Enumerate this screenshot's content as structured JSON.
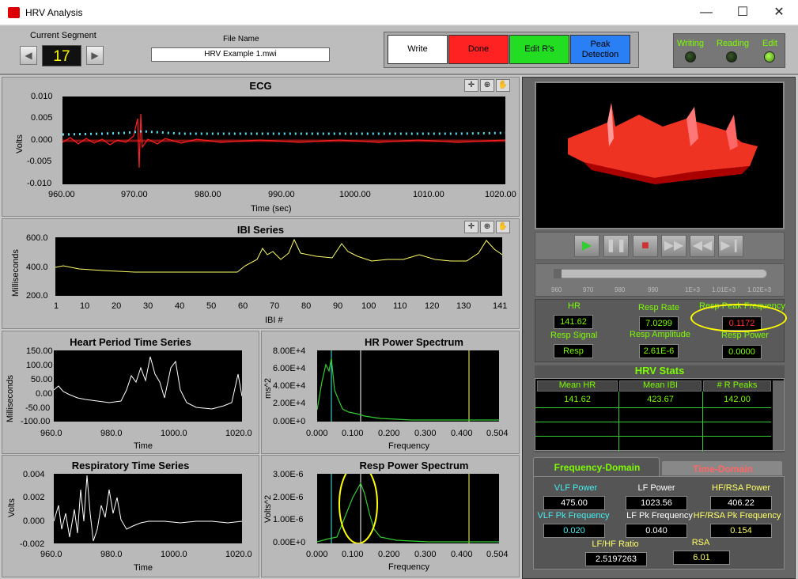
{
  "window": {
    "title": "HRV Analysis",
    "minimize": "—",
    "maximize": "☐",
    "close": "✕"
  },
  "segment": {
    "label": "Current Segment",
    "value": "17",
    "prev": "◀",
    "next": "▶"
  },
  "file": {
    "label": "File Name",
    "value": "HRV Example 1.mwi"
  },
  "buttons": {
    "write": "Write",
    "done": "Done",
    "edit_rs": "Edit R's",
    "peak_detection": "Peak Detection"
  },
  "leds": {
    "writing": "Writing",
    "reading": "Reading",
    "edit": "Edit"
  },
  "ecg": {
    "title": "ECG",
    "ylabel": "Volts",
    "xlabel": "Time (sec)",
    "yticks": [
      "0.010",
      "0.005",
      "0.000",
      "-0.005",
      "-0.010"
    ],
    "xticks": [
      "960.00",
      "970.00",
      "980.00",
      "990.00",
      "1000.00",
      "1010.00",
      "1020.00"
    ]
  },
  "ibi": {
    "title": "IBI Series",
    "ylabel": "Milliseconds",
    "xlabel": "IBI #",
    "yticks": [
      "600.0",
      "400.0",
      "200.0"
    ],
    "xticks": [
      "1",
      "10",
      "20",
      "30",
      "40",
      "50",
      "60",
      "70",
      "80",
      "90",
      "100",
      "110",
      "120",
      "130",
      "141"
    ]
  },
  "hpts": {
    "title": "Heart Period Time Series",
    "ylabel": "Milliseconds",
    "xlabel": "Time",
    "yticks": [
      "150.00",
      "100.00",
      "50.00",
      "0.00",
      "-50.00",
      "-100.00"
    ],
    "xticks": [
      "960.0",
      "980.0",
      "1000.0",
      "1020.0"
    ]
  },
  "hrps": {
    "title": "HR Power Spectrum",
    "ylabel": "ms^2",
    "xlabel": "Frequency",
    "yticks": [
      "8.00E+4",
      "6.00E+4",
      "4.00E+4",
      "2.00E+4",
      "0.00E+0"
    ],
    "xticks": [
      "0.000",
      "0.100",
      "0.200",
      "0.300",
      "0.400",
      "0.504"
    ]
  },
  "rts": {
    "title": "Respiratory Time Series",
    "ylabel": "Volts",
    "xlabel": "Time",
    "yticks": [
      "0.004",
      "0.002",
      "0.000",
      "-0.002"
    ],
    "xticks": [
      "960.0",
      "980.0",
      "1000.0",
      "1020.0"
    ]
  },
  "rps": {
    "title": "Resp Power Spectrum",
    "ylabel": "Volts^2",
    "xlabel": "Frequency",
    "yticks": [
      "3.00E-6",
      "2.00E-6",
      "1.00E-6",
      "0.00E+0"
    ],
    "xticks": [
      "0.000",
      "0.100",
      "0.200",
      "0.300",
      "0.400",
      "0.504"
    ]
  },
  "slider": {
    "ticks": [
      "960",
      "970",
      "980",
      "990",
      "1E+3",
      "1.01E+3",
      "1.02E+3"
    ]
  },
  "indicators": {
    "hr_label": "HR",
    "hr": "141.62",
    "resp_rate_label": "Resp Rate",
    "resp_rate": "7.0299",
    "resp_peak_label": "Resp Peak Frequency",
    "resp_peak": "0.1172",
    "resp_signal_label": "Resp Signal",
    "resp_signal": "Resp",
    "resp_amp_label": "Resp Amplitude",
    "resp_amp": "2.61E-6",
    "resp_power_label": "Resp Power",
    "resp_power": "0.0000"
  },
  "hrv_stats": {
    "title": "HRV Stats",
    "columns": [
      "Mean HR",
      "Mean IBI",
      "# R Peaks"
    ],
    "row": [
      "141.62",
      "423.67",
      "142.00"
    ]
  },
  "freq": {
    "tab_fd": "Frequency-Domain",
    "tab_td": "Time-Domain",
    "vlf_power_label": "VLF  Power",
    "vlf_power": "475.00",
    "lf_power_label": "LF Power",
    "lf_power": "1023.56",
    "hf_power_label": "HF/RSA Power",
    "hf_power": "406.22",
    "vlf_pk_label": "VLF Pk Frequency",
    "vlf_pk": "0.020",
    "lf_pk_label": "LF Pk Frequency",
    "lf_pk": "0.040",
    "hf_pk_label": "HF/RSA Pk Frequency",
    "hf_pk": "0.154",
    "lfhf_label": "LF/HF Ratio",
    "lfhf": "2.5197263",
    "rsa_label": "RSA",
    "rsa": "6.01"
  },
  "colors": {
    "accent_green": "#7cfc00",
    "highlight": "#ffff00",
    "trace_red": "#ff2020",
    "trace_cyan": "#55ddee"
  }
}
